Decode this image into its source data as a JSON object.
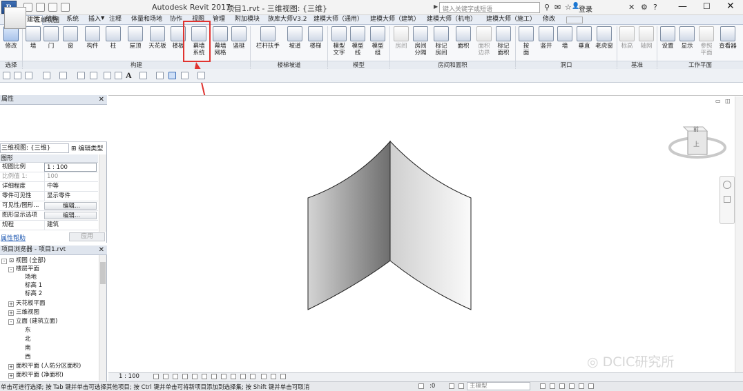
{
  "window": {
    "title_app": "Autodesk Revit 2017 -",
    "title_doc": "项目1.rvt - 三维视图: {三维}",
    "search_placeholder": "键入关键字或短语",
    "login": "登录"
  },
  "tabs": [
    "建筑",
    "结构",
    "系统",
    "插入",
    "注释",
    "体量和场地",
    "协作",
    "视图",
    "管理",
    "附加模块",
    "族库大师V3.2",
    "建模大师（通用）",
    "建模大师（建筑）",
    "建模大师（机电）",
    "建模大师（施工）",
    "修改"
  ],
  "ribbon": {
    "buttons": [
      {
        "label": "修改",
        "label2": ""
      },
      {
        "label": "墙",
        "label2": ""
      },
      {
        "label": "门",
        "label2": ""
      },
      {
        "label": "窗",
        "label2": ""
      },
      {
        "label": "构件",
        "label2": ""
      },
      {
        "label": "柱",
        "label2": ""
      },
      {
        "label": "屋顶",
        "label2": ""
      },
      {
        "label": "天花板",
        "label2": ""
      },
      {
        "label": "楼板",
        "label2": ""
      },
      {
        "label": "幕墙",
        "label2": "系统"
      },
      {
        "label": "幕墙",
        "label2": "网格"
      },
      {
        "label": "竖梃",
        "label2": ""
      },
      {
        "label": "栏杆扶手",
        "label2": ""
      },
      {
        "label": "坡道",
        "label2": ""
      },
      {
        "label": "楼梯",
        "label2": ""
      },
      {
        "label": "模型",
        "label2": "文字"
      },
      {
        "label": "模型",
        "label2": "线"
      },
      {
        "label": "模型",
        "label2": "组"
      },
      {
        "label": "房间",
        "label2": ""
      },
      {
        "label": "房间",
        "label2": "分隔"
      },
      {
        "label": "标记",
        "label2": "房间"
      },
      {
        "label": "面积",
        "label2": ""
      },
      {
        "label": "面积",
        "label2": "边界"
      },
      {
        "label": "标记",
        "label2": "面积"
      },
      {
        "label": "按",
        "label2": "面"
      },
      {
        "label": "竖井",
        "label2": ""
      },
      {
        "label": "墙",
        "label2": ""
      },
      {
        "label": "垂直",
        "label2": ""
      },
      {
        "label": "老虎窗",
        "label2": ""
      },
      {
        "label": "标高",
        "label2": ""
      },
      {
        "label": "轴网",
        "label2": ""
      },
      {
        "label": "设置",
        "label2": ""
      },
      {
        "label": "显示",
        "label2": ""
      },
      {
        "label": "参照",
        "label2": "平面"
      },
      {
        "label": "查看器",
        "label2": ""
      }
    ],
    "panels": [
      "选择",
      "构建",
      "楼梯坡道",
      "模型",
      "房间和面积",
      "洞口",
      "基准",
      "工作平面"
    ]
  },
  "properties": {
    "title": "属性",
    "type_name": "三维视图",
    "view_selector": "三维视图: {三维}",
    "edit_type": "编辑类型",
    "category": "图形",
    "rows": [
      {
        "key": "视图比例",
        "value": "1 : 100"
      },
      {
        "key": "比例值 1:",
        "value": "100"
      },
      {
        "key": "详细程度",
        "value": "中等"
      },
      {
        "key": "零件可见性",
        "value": "显示零件"
      },
      {
        "key": "可见性/图形...",
        "value": "编辑..."
      },
      {
        "key": "图形显示选项",
        "value": "编辑..."
      },
      {
        "key": "规程",
        "value": "建筑"
      }
    ],
    "help": "属性帮助",
    "apply": "应用"
  },
  "browser": {
    "title": "项目浏览器 - 项目1.rvt",
    "items": [
      {
        "label": "视图 (全部)",
        "level": 0,
        "toggle": "-"
      },
      {
        "label": "楼层平面",
        "level": 1,
        "toggle": "-"
      },
      {
        "label": "场地",
        "level": 2,
        "toggle": ""
      },
      {
        "label": "标高 1",
        "level": 2,
        "toggle": ""
      },
      {
        "label": "标高 2",
        "level": 2,
        "toggle": ""
      },
      {
        "label": "天花板平面",
        "level": 1,
        "toggle": "+"
      },
      {
        "label": "三维视图",
        "level": 1,
        "toggle": "+"
      },
      {
        "label": "立面 (建筑立面)",
        "level": 1,
        "toggle": "-"
      },
      {
        "label": "东",
        "level": 2,
        "toggle": ""
      },
      {
        "label": "北",
        "level": 2,
        "toggle": ""
      },
      {
        "label": "南",
        "level": 2,
        "toggle": ""
      },
      {
        "label": "西",
        "level": 2,
        "toggle": ""
      },
      {
        "label": "面积平面 (人防分区面积)",
        "level": 1,
        "toggle": "+"
      },
      {
        "label": "面积平面 (净面积)",
        "level": 1,
        "toggle": "+"
      }
    ]
  },
  "viewcube": {
    "top": "前",
    "front": "上"
  },
  "viewbar": {
    "scale": "1 : 100"
  },
  "status": {
    "text": "单击可进行选择; 按 Tab 键并单击可选择其他项目; 按 Ctrl 键并单击可将新项目添加到选择集; 按 Shift 键并单击可取消",
    "zero": ":0",
    "model": "主模型"
  },
  "watermark": "DCIC研究所",
  "colors": {
    "highlight": "#e0332f",
    "arrow": "#e0332f"
  }
}
